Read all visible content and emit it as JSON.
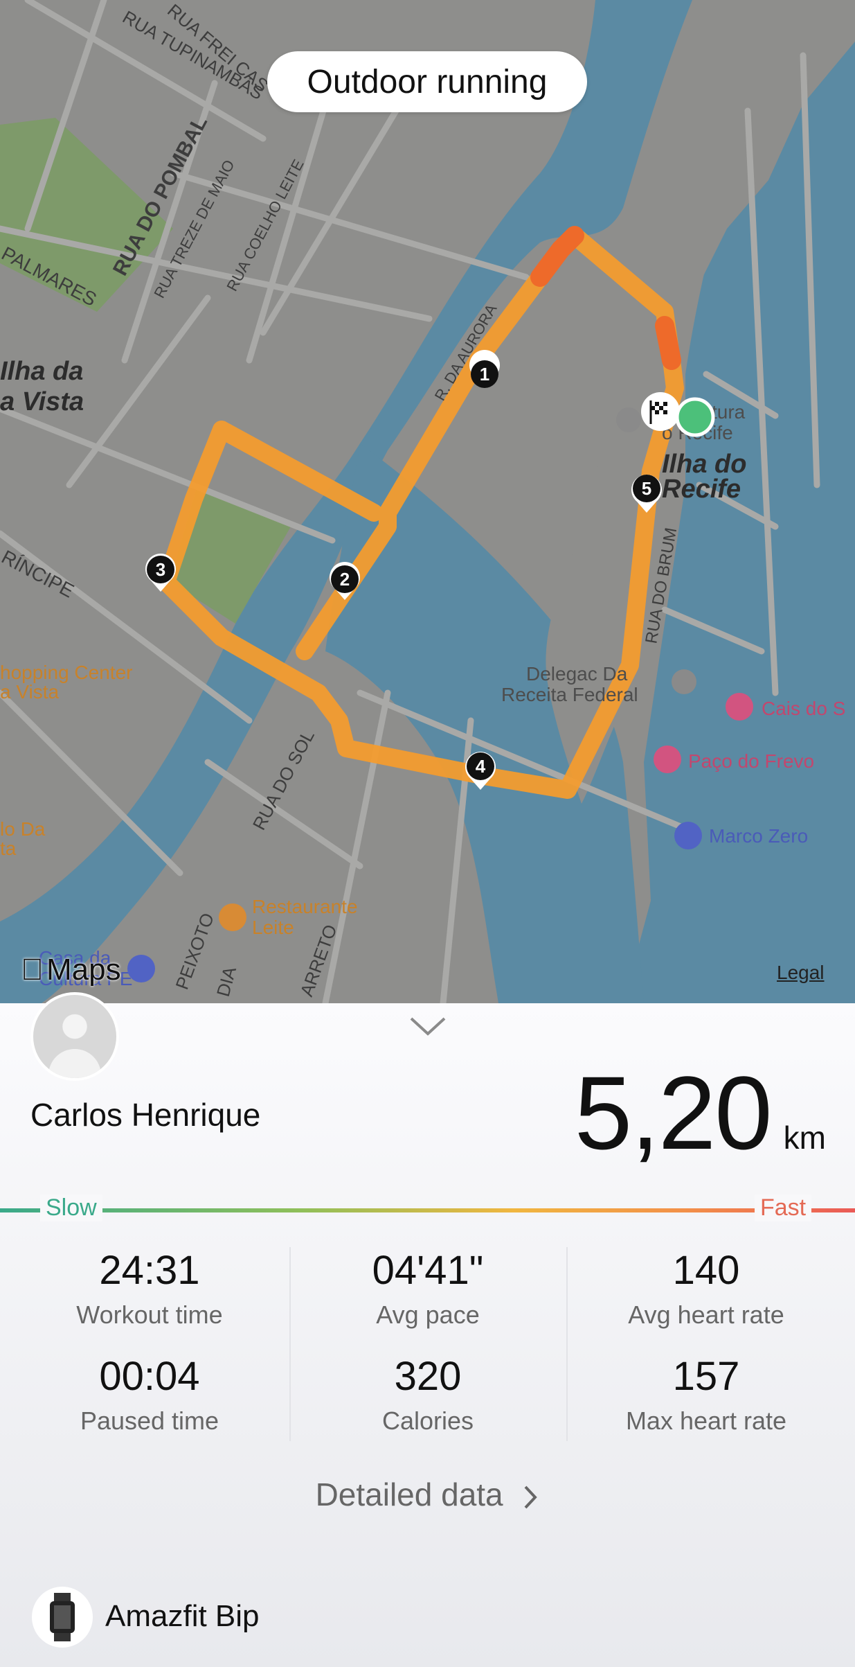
{
  "activity": {
    "title": "Outdoor running"
  },
  "map": {
    "attribution": "Maps",
    "legal": "Legal",
    "labels": {
      "street_1": "RUA FREI CAS",
      "street_2": "RUA TUPINAMBÁS",
      "street_3": "RUA DO POMBAL",
      "street_4": "RUA TREZE DE MAIO",
      "street_5": "RUA COELHO LEITE",
      "street_6": "PALMARES",
      "district_1a": "Ilha da",
      "district_1b": "a Vista",
      "district_2a": "Ilha do",
      "district_2b": "Recife",
      "street_7": "RÍNCIPE",
      "street_8": "RUA DO BRUM",
      "poi_shopping_a": "hopping Center",
      "poi_shopping_b": "a Vista",
      "poi_receita_a": "Delegac  Da",
      "poi_receita_b": "Receita Federal",
      "poi_cultura_a": "tura",
      "poi_cultura_b": "o Recife",
      "poi_cais": "Cais do S",
      "poi_paco": "Paço do Frevo",
      "poi_marco": "Marco Zero",
      "street_9": "RUA DO SOL",
      "poi_do_da_a": "lo Da",
      "poi_do_da_b": "ta",
      "poi_restaurante_a": "Restaurante",
      "poi_restaurante_b": "Leite",
      "poi_casa_a": "Casa da",
      "poi_casa_b": "Cultura PE",
      "street_10": "PEIXOTO",
      "street_11": "DIA",
      "street_12": "ARRETO",
      "street_13": "R. DA AURORA"
    },
    "markers": [
      "1",
      "2",
      "3",
      "4",
      "5"
    ],
    "colors": {
      "route": "#f39c2f",
      "route_fast": "#ee6a2a",
      "water": "#5b8aa3",
      "land": "#8d8d8b",
      "park": "#7e9a6a",
      "start": "#4cc07a"
    }
  },
  "user": {
    "name": "Carlos Henrique"
  },
  "summary": {
    "distance": "5,20",
    "unit": "km"
  },
  "pace_scale": {
    "slow": "Slow",
    "fast": "Fast"
  },
  "stats": [
    {
      "value": "24:31",
      "label": "Workout time"
    },
    {
      "value": "04'41\"",
      "label": "Avg pace"
    },
    {
      "value": "140",
      "label": "Avg heart rate"
    },
    {
      "value": "00:04",
      "label": "Paused time"
    },
    {
      "value": "320",
      "label": "Calories"
    },
    {
      "value": "157",
      "label": "Max heart rate"
    }
  ],
  "detail_link": "Detailed data",
  "device": {
    "name": "Amazfit Bip"
  }
}
